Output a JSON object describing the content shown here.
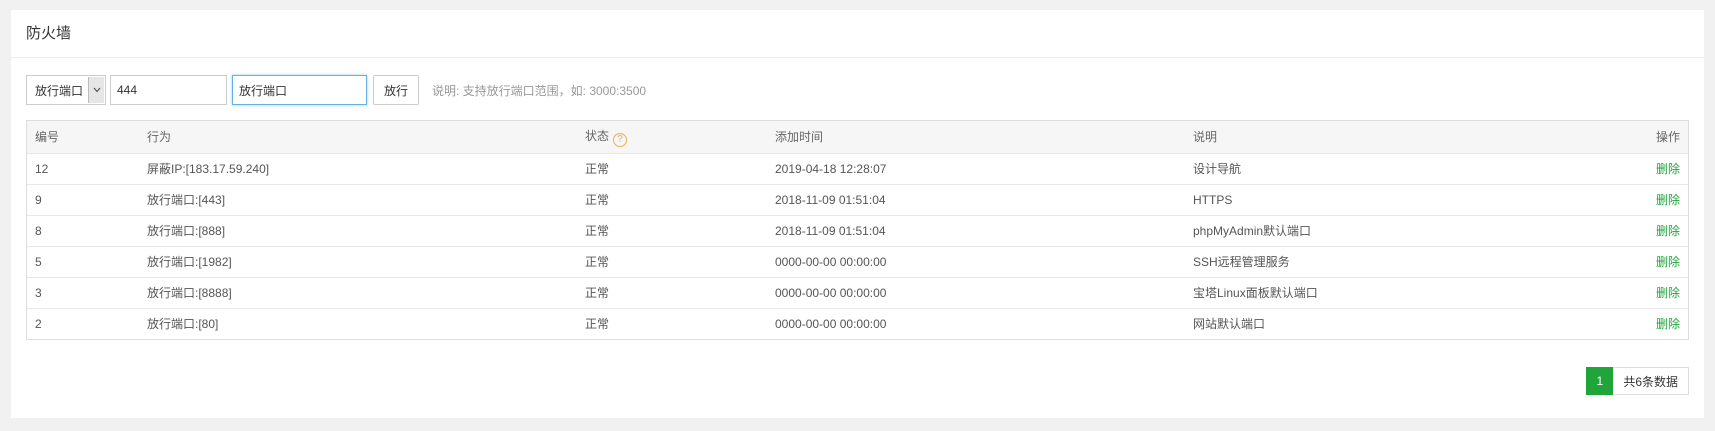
{
  "panel": {
    "title": "防火墙"
  },
  "toolbar": {
    "type_select": "放行端口",
    "port_value": "444",
    "desc_value": "放行端口",
    "submit_label": "放行",
    "hint": "说明: 支持放行端口范围，如: 3000:3500"
  },
  "table": {
    "headers": {
      "id": "编号",
      "action": "行为",
      "status": "状态",
      "time": "添加时间",
      "desc": "说明",
      "op": "操作"
    },
    "rows": [
      {
        "id": "12",
        "action": "屏蔽IP:[183.17.59.240]",
        "status": "正常",
        "time": "2019-04-18 12:28:07",
        "desc": "设计导航",
        "op": "删除"
      },
      {
        "id": "9",
        "action": "放行端口:[443]",
        "status": "正常",
        "time": "2018-11-09 01:51:04",
        "desc": "HTTPS",
        "op": "删除"
      },
      {
        "id": "8",
        "action": "放行端口:[888]",
        "status": "正常",
        "time": "2018-11-09 01:51:04",
        "desc": "phpMyAdmin默认端口",
        "op": "删除"
      },
      {
        "id": "5",
        "action": "放行端口:[1982]",
        "status": "正常",
        "time": "0000-00-00 00:00:00",
        "desc": "SSH远程管理服务",
        "op": "删除"
      },
      {
        "id": "3",
        "action": "放行端口:[8888]",
        "status": "正常",
        "time": "0000-00-00 00:00:00",
        "desc": "宝塔Linux面板默认端口",
        "op": "删除"
      },
      {
        "id": "2",
        "action": "放行端口:[80]",
        "status": "正常",
        "time": "0000-00-00 00:00:00",
        "desc": "网站默认端口",
        "op": "删除"
      }
    ]
  },
  "pager": {
    "current": "1",
    "total": "共6条数据"
  },
  "colors": {
    "accent": "#20a53a",
    "help": "#f0ad4e",
    "focus": "#66afe9"
  }
}
